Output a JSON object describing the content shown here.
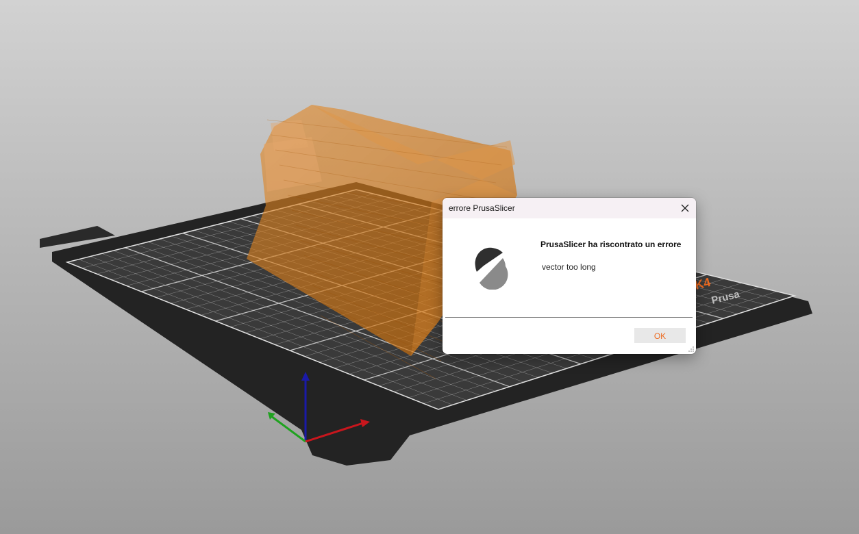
{
  "window": {
    "background_top": "#d2d2d2",
    "background_bottom": "#9a9a9a"
  },
  "scene": {
    "bed_color": "#2e2e2e",
    "grid_color": "#dcdcdc",
    "model_color": "#e07a10",
    "axis_x_color": "#c8161d",
    "axis_y_color": "#1fa21f",
    "axis_z_color": "#1a1aa8",
    "bed_brand_text": "Prusa",
    "bed_model_text": "K4",
    "bed_brand_color": "#ed6b21"
  },
  "dialog": {
    "title": "errore PrusaSlicer",
    "close_icon": "close-icon",
    "heading": "PrusaSlicer ha riscontrato un errore",
    "message": "vector too long",
    "ok_label": "OK",
    "accent": "#ed6b21",
    "logo_icon": "prusaslicer-logo-icon"
  }
}
